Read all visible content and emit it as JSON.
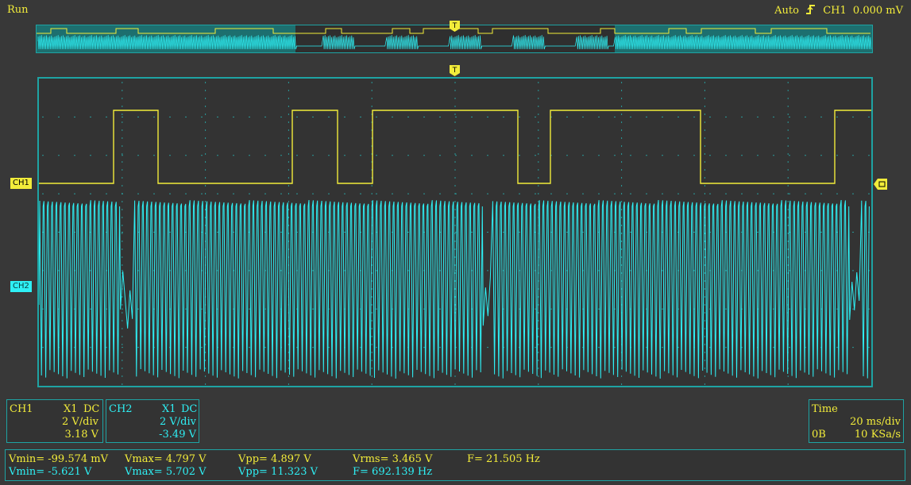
{
  "status": {
    "mode": "Run"
  },
  "trigger": {
    "mode": "Auto",
    "source": "CH1",
    "level": "0.000 mV",
    "edge_icon": "rising-edge-icon"
  },
  "colors": {
    "ch1": "#f2ec3a",
    "ch2": "#2ef0f5",
    "frame": "#1ea3a3",
    "background": "#333333"
  },
  "markers": {
    "trigger_marker": "T"
  },
  "channels": {
    "ch1": {
      "tag": "CH1",
      "probe": "X1",
      "coupling": "DC",
      "scale": "2 V/div",
      "offset": "3.18 V"
    },
    "ch2": {
      "tag": "CH2",
      "probe": "X1",
      "coupling": "DC",
      "scale": "2 V/div",
      "offset": "-3.49 V"
    }
  },
  "timebase": {
    "title": "Time",
    "scale": "20 ms/div",
    "memory": "0B",
    "sample_rate": "10 KSa/s"
  },
  "measurements": {
    "ch1": {
      "vmin": "Vmin= -99.574 mV",
      "vmax": "Vmax= 4.797 V",
      "vpp": "Vpp= 4.897 V",
      "vrms": "Vrms= 3.465 V",
      "freq": "F= 21.505 Hz"
    },
    "ch2": {
      "vmin": "Vmin= -5.621 V",
      "vmax": "Vmax= 5.702 V",
      "vpp": "Vpp= 11.323 V",
      "freq": "F= 692.139 Hz"
    }
  }
}
